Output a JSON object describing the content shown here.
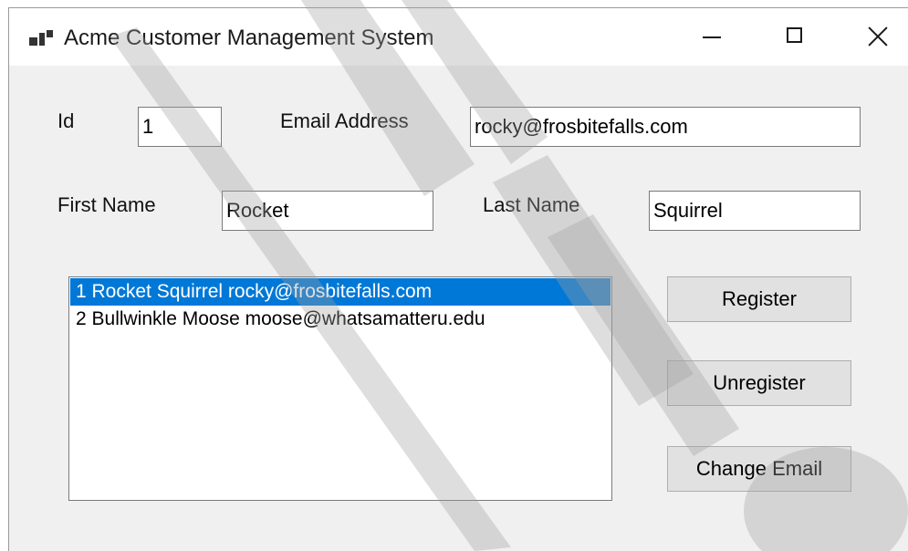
{
  "window": {
    "title": "Acme Customer Management System"
  },
  "form": {
    "id_label": "Id",
    "id_value": "1",
    "email_label": "Email Address",
    "email_value": "rocky@frosbitefalls.com",
    "first_name_label": "First Name",
    "first_name_value": "Rocket",
    "last_name_label": "Last Name",
    "last_name_value": "Squirrel"
  },
  "customer_list": {
    "items": [
      "1 Rocket Squirrel rocky@frosbitefalls.com",
      "2 Bullwinkle Moose moose@whatsamatteru.edu"
    ],
    "selected_index": 0
  },
  "buttons": {
    "register": "Register",
    "unregister": "Unregister",
    "change_email": "Change Email"
  },
  "colors": {
    "selection": "#0078d7",
    "window_bg": "#f0f0f0"
  }
}
